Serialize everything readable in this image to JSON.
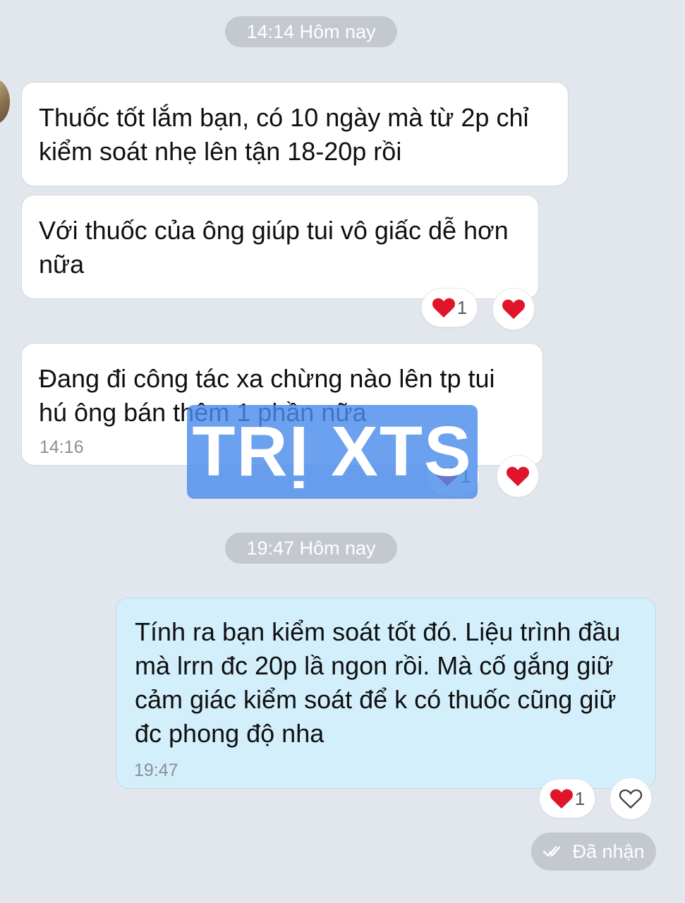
{
  "messages": {
    "time_pill_1": "14:14 Hôm nay",
    "incoming_1": "Thuốc tốt lắm bạn, có 10 ngày mà từ 2p chỉ kiểm soát nhẹ lên tận 18-20p rồi",
    "incoming_2": "Với thuốc của ông giúp tui vô giấc dễ hơn nữa",
    "incoming_2_reaction_count": "1",
    "incoming_3": "Đang đi công tác xa chừng nào lên tp tui hú ông bán thêm 1 phần nữa",
    "incoming_3_time": "14:16",
    "incoming_3_reaction_count": "1",
    "time_pill_2": "19:47 Hôm nay",
    "outgoing_1": "Tính ra bạn kiểm soát tốt đó. Liệu trình đầu mà lrrn đc 20p lầ ngon rồi. Mà cố gắng giữ cảm giác kiểm soát để k có thuốc cũng giữ đc phong độ nha",
    "outgoing_1_time": "19:47",
    "outgoing_1_reaction_count": "1",
    "status": "Đã nhận"
  },
  "watermark": "TRỊ XTS",
  "icons": {
    "heart_color": "#e0152a",
    "heart": "heart-icon",
    "heart_outline": "heart-outline-icon",
    "double_check": "double-check-icon"
  }
}
